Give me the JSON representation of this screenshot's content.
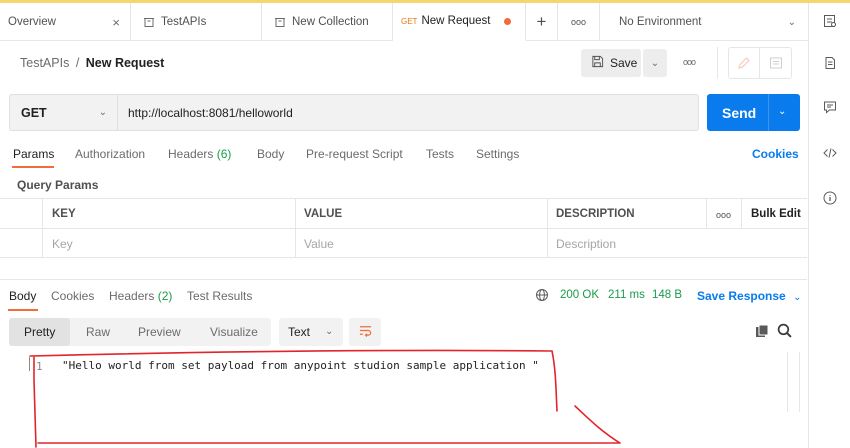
{
  "tabs": [
    {
      "label": "Overview",
      "close": "×"
    },
    {
      "label": "TestAPIs"
    },
    {
      "label": "New Collection"
    },
    {
      "method": "GET",
      "label": "New Request"
    }
  ],
  "tabbar": {
    "add": "+",
    "more": "ooo",
    "environment": "No Environment"
  },
  "breadcrumb": {
    "collection": "TestAPIs",
    "separator": "/",
    "request": "New Request"
  },
  "header": {
    "save_label": "Save",
    "more": "ooo"
  },
  "request": {
    "method": "GET",
    "url": "http://localhost:8081/helloworld",
    "send_label": "Send"
  },
  "request_tabs": [
    {
      "label": "Params"
    },
    {
      "label": "Authorization"
    },
    {
      "label": "Headers",
      "count": "(6)"
    },
    {
      "label": "Body"
    },
    {
      "label": "Pre-request Script"
    },
    {
      "label": "Tests"
    },
    {
      "label": "Settings"
    }
  ],
  "cookies_label": "Cookies",
  "query_params": {
    "title": "Query Params",
    "columns": [
      "KEY",
      "VALUE",
      "DESCRIPTION"
    ],
    "more": "ooo",
    "bulk_edit": "Bulk Edit",
    "placeholders": {
      "key": "Key",
      "value": "Value",
      "description": "Description"
    }
  },
  "response_tabs": [
    {
      "label": "Body"
    },
    {
      "label": "Cookies"
    },
    {
      "label": "Headers",
      "count": "(2)"
    },
    {
      "label": "Test Results"
    }
  ],
  "response_status": {
    "status": "200 OK",
    "time": "211 ms",
    "size": "148 B"
  },
  "save_response": "Save Response",
  "view_modes": [
    "Pretty",
    "Raw",
    "Preview",
    "Visualize"
  ],
  "format": "Text",
  "response_body": [
    {
      "line": "1",
      "text": "\"Hello world from set payload from anypoint studion sample application \""
    }
  ],
  "colors": {
    "accent_orange": "#f26b3a",
    "send_blue": "#097bed",
    "status_green": "#1b9b4c",
    "annotation_red": "#e0262b"
  },
  "icons": {
    "tab_collection": "collection-icon",
    "rightbar": [
      "environment-quick-look-icon",
      "documentation-icon",
      "comments-icon",
      "code-icon",
      "info-icon"
    ],
    "response": [
      "globe-icon",
      "copy-icon",
      "search-icon",
      "wrap-lines-icon"
    ]
  }
}
